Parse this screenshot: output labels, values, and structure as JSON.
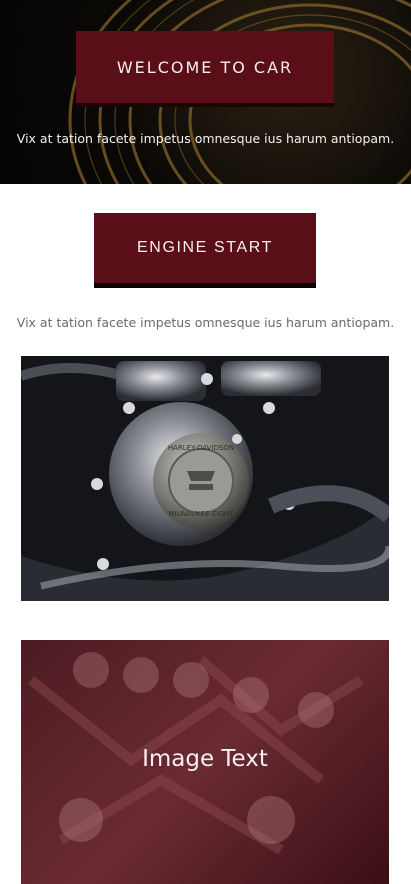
{
  "hero": {
    "title": "WELCOME TO CAR",
    "text": "Vix at tation facete impetus omnesque ius harum antiopam."
  },
  "cta": {
    "label": "ENGINE START"
  },
  "content": {
    "text": "Vix at tation facete impetus omnesque ius harum antiopam."
  },
  "engine_image": {
    "emblem_text_top": "HARLEY-DAVIDSON",
    "emblem_text_bottom": "MILWAUKEE-EIGHT"
  },
  "overlay_card": {
    "label": "Image Text"
  },
  "colors": {
    "accent": "#5a0e18",
    "overlay": "#6a2a31"
  }
}
